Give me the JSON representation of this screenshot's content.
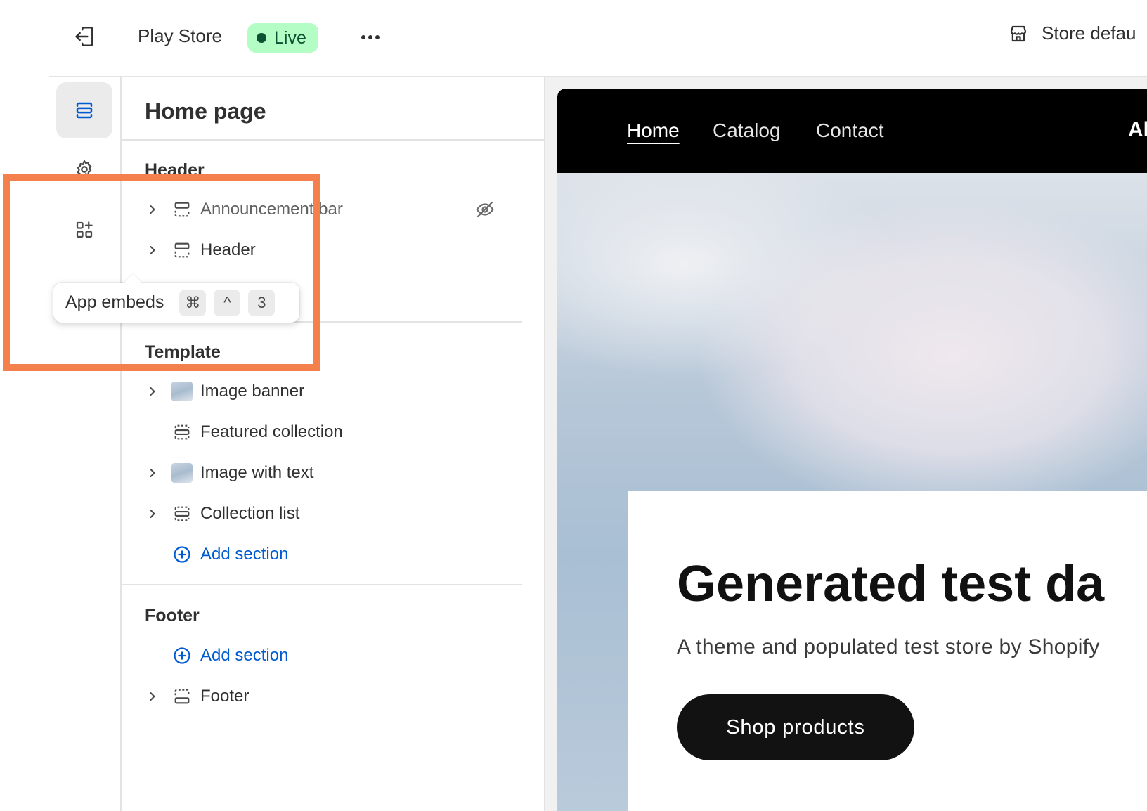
{
  "topbar": {
    "store_name": "Play Store",
    "status_label": "Live",
    "status_color": "#b4fec6",
    "store_default_label": "Store defau",
    "exit_icon": "exit-icon",
    "more_icon": "more-horizontal-icon",
    "store_icon": "store-icon"
  },
  "rail": {
    "items": [
      {
        "icon": "sections-icon",
        "active": true
      },
      {
        "icon": "gear-icon",
        "active": false
      },
      {
        "icon": "app-embeds-icon",
        "active": false
      }
    ]
  },
  "panel": {
    "title": "Home page",
    "groups": [
      {
        "title": "Header",
        "items": [
          {
            "label": "Announcement bar",
            "icon": "section-icon",
            "expandable": true,
            "hidden": true
          },
          {
            "label": "Header",
            "icon": "section-icon",
            "expandable": true
          }
        ]
      },
      {
        "title": "Template",
        "items": [
          {
            "label": "Image banner",
            "icon": "image-thumbnail",
            "expandable": true
          },
          {
            "label": "Featured collection",
            "icon": "section-icon",
            "expandable": false
          },
          {
            "label": "Image with text",
            "icon": "image-thumbnail",
            "expandable": true
          },
          {
            "label": "Collection list",
            "icon": "section-icon",
            "expandable": true
          }
        ],
        "add_label": "Add section"
      },
      {
        "title": "Footer",
        "add_label": "Add section",
        "items": [
          {
            "label": "Footer",
            "icon": "footer-section-icon",
            "expandable": true
          }
        ]
      }
    ]
  },
  "tooltip": {
    "label": "App embeds",
    "keys": [
      "⌘",
      "^",
      "3"
    ]
  },
  "preview": {
    "nav": [
      "Home",
      "Catalog",
      "Contact"
    ],
    "brand_fragment": "Al",
    "hero_title": "Generated test da",
    "hero_subtitle": "A theme and populated test store by Shopify",
    "hero_button": "Shop products"
  },
  "highlight_color": "#f4804d"
}
